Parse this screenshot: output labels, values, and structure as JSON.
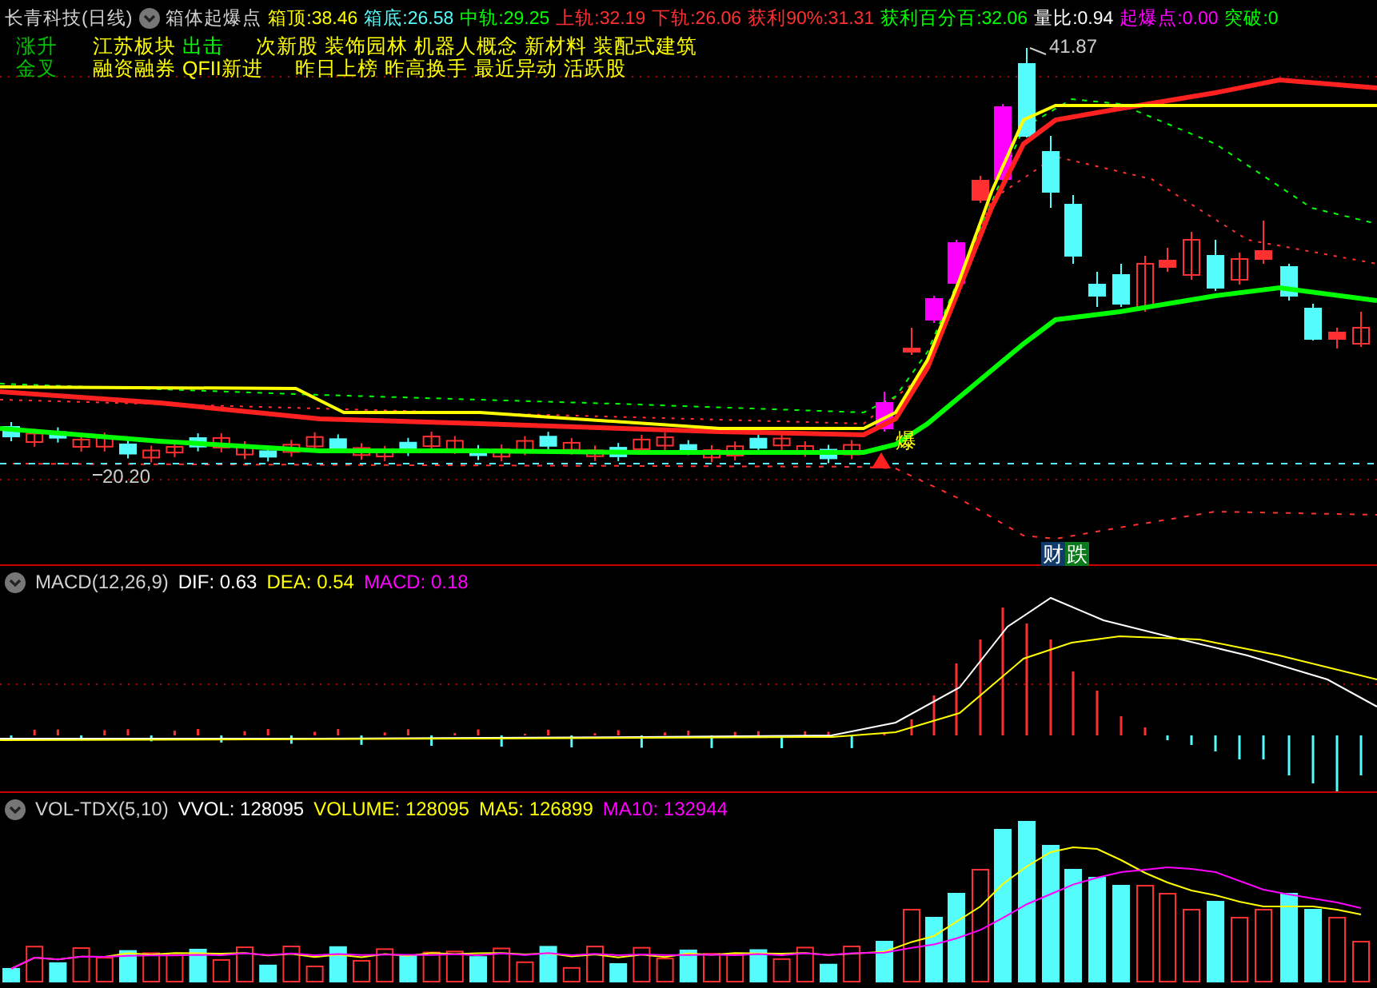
{
  "header": {
    "stock": "长青科技(日线)",
    "indicator": "箱体起爆点",
    "stats": [
      {
        "label": "箱顶:",
        "value": "38.46",
        "color": "#ffff00"
      },
      {
        "label": "箱底:",
        "value": "26.58",
        "color": "#54fcfc"
      },
      {
        "label": "中轨:",
        "value": "29.25",
        "color": "#00ff00"
      },
      {
        "label": "上轨:",
        "value": "32.19",
        "color": "#ff3030"
      },
      {
        "label": "下轨:",
        "value": "26.06",
        "color": "#ff3030"
      },
      {
        "label": "获利90%:",
        "value": "31.31",
        "color": "#ff3030"
      },
      {
        "label": "获利百分百:",
        "value": "32.06",
        "color": "#00ff00"
      },
      {
        "label": "量比:",
        "value": "0.94",
        "color": "#ffffff"
      },
      {
        "label": "起爆点:",
        "value": "0.00",
        "color": "#ff00ff"
      },
      {
        "label": "突破:",
        "value": "0",
        "color": "#00ff00"
      }
    ]
  },
  "tag_rows": [
    {
      "label": "涨升",
      "tags": [
        {
          "text": "江苏板块",
          "color": "#ffff00"
        },
        {
          "text": "出击",
          "color": "#00ff00"
        },
        {
          "text": "次新股",
          "color": "#ffff00"
        },
        {
          "text": "装饰园林",
          "color": "#ffff00"
        },
        {
          "text": "机器人概念",
          "color": "#ffff00"
        },
        {
          "text": "新材料",
          "color": "#ffff00"
        },
        {
          "text": "装配式建筑",
          "color": "#ffff00"
        }
      ]
    },
    {
      "label": "金叉",
      "tags": [
        {
          "text": "融资融券",
          "color": "#ffff00"
        },
        {
          "text": "QFII新进",
          "color": "#ffff00"
        },
        {
          "text": "昨日上榜",
          "color": "#ffff00"
        },
        {
          "text": "昨高换手",
          "color": "#ffff00"
        },
        {
          "text": "最近异动",
          "color": "#ffff00"
        },
        {
          "text": "活跃股",
          "color": "#ffff00"
        }
      ]
    }
  ],
  "price_marks": [
    {
      "kind": "high",
      "text": "41.87"
    },
    {
      "kind": "low",
      "text": "20.20"
    }
  ],
  "signals": [
    {
      "kind": "burst",
      "text": "爆"
    },
    {
      "kind": "finance",
      "text": "财"
    },
    {
      "kind": "fall",
      "text": "跌"
    }
  ],
  "macd": {
    "name": "MACD(12,26,9)",
    "stats": [
      {
        "label": "DIF:",
        "value": "0.63",
        "color": "#ffffff"
      },
      {
        "label": "DEA:",
        "value": "0.54",
        "color": "#ffff00"
      },
      {
        "label": "MACD:",
        "value": "0.18",
        "color": "#ff00ff"
      }
    ]
  },
  "volume": {
    "name": "VOL-TDX(5,10)",
    "stats": [
      {
        "label": "VVOL:",
        "value": "128095",
        "color": "#ffffff"
      },
      {
        "label": "VOLUME:",
        "value": "128095",
        "color": "#ffff00"
      },
      {
        "label": "MA5:",
        "value": "126899",
        "color": "#ffff00"
      },
      {
        "label": "MA10:",
        "value": "132944",
        "color": "#ff00ff"
      }
    ]
  }
}
